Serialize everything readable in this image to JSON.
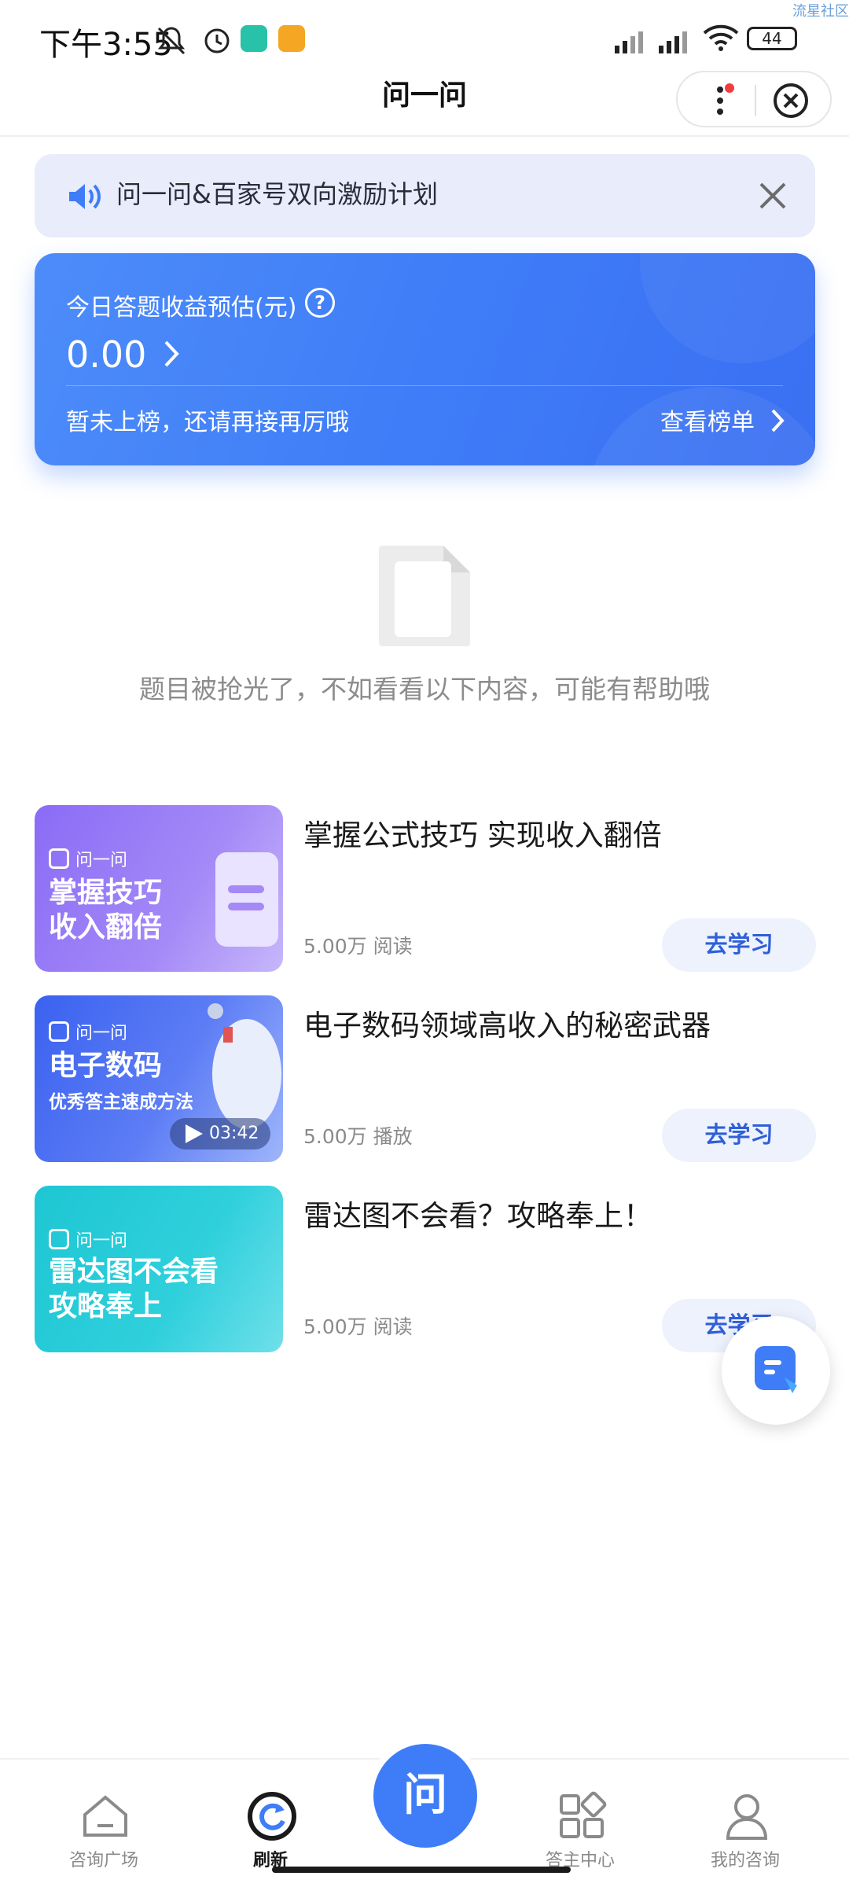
{
  "status_bar": {
    "time": "下午3:55",
    "battery": "44",
    "watermark": "流星社区"
  },
  "header": {
    "title": "问一问"
  },
  "notice": {
    "text": "问一问&百家号双向激励计划"
  },
  "earnings": {
    "label": "今日答题收益预估(元)",
    "help": "?",
    "amount": "0.00",
    "sub_text": "暂未上榜，还请再接再厉哦",
    "rank_link": "查看榜单"
  },
  "empty_state": {
    "text": "题目被抢光了，不如看看以下内容，可能有帮助哦"
  },
  "items": [
    {
      "thumb_brand": "问一问",
      "thumb_line1": "掌握技巧",
      "thumb_line2": "收入翻倍",
      "title": "掌握公式技巧 实现收入翻倍",
      "meta": "5.00万 阅读",
      "button": "去学习"
    },
    {
      "thumb_brand": "问一问",
      "thumb_line1": "电子数码",
      "thumb_sub": "优秀答主速成方法",
      "duration": "03:42",
      "title": "电子数码领域高收入的秘密武器",
      "meta": "5.00万 播放",
      "button": "去学习"
    },
    {
      "thumb_brand": "问一问",
      "thumb_line1": "雷达图不会看",
      "thumb_line2": "攻略奉上",
      "title": "雷达图不会看？攻略奉上！",
      "meta": "5.00万 阅读",
      "button": "去学习"
    }
  ],
  "bottom_nav": {
    "items": [
      {
        "label": "咨询广场",
        "icon": "home-icon"
      },
      {
        "label": "刷新",
        "icon": "refresh-icon"
      },
      {
        "label": "问",
        "icon": "ask-icon"
      },
      {
        "label": "答主中心",
        "icon": "grid-icon"
      },
      {
        "label": "我的咨询",
        "icon": "person-icon"
      }
    ]
  },
  "colors": {
    "accent": "#3f7df8",
    "notice_bg": "#e8ecfb",
    "button_bg": "#eef2fd"
  }
}
